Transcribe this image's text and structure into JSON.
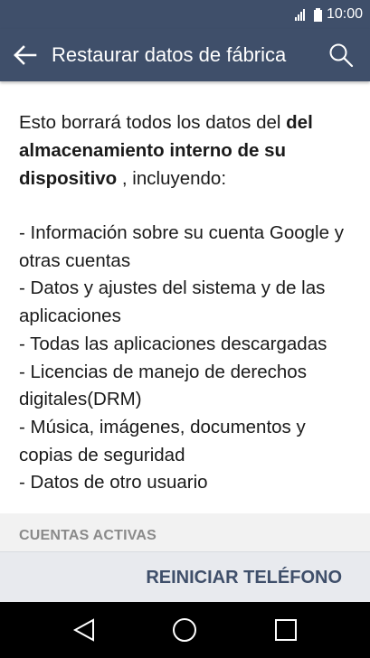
{
  "status_bar": {
    "time": "10:00",
    "signal_icon": "signal-bars-icon",
    "battery_icon": "battery-full-icon"
  },
  "app_bar": {
    "title": "Restaurar datos de fábrica",
    "back_icon": "arrow-left-icon",
    "search_icon": "search-icon",
    "background": "#3f4f6a"
  },
  "content": {
    "intro_start": "Esto borrará todos los datos del ",
    "intro_bold": "del almacenamiento interno de su dispositivo",
    "intro_end": " , incluyendo:",
    "items": [
      "- Información sobre su cuenta Google y otras cuentas",
      "- Datos y ajustes del sistema y de las aplicaciones",
      "- Todas las aplicaciones descargadas",
      "- Licencias de manejo de derechos digitales(DRM)",
      "- Música, imágenes, documentos y copias de seguridad",
      "- Datos de otro usuario"
    ]
  },
  "accounts_section": {
    "header": "CUENTAS ACTIVAS"
  },
  "action": {
    "reset_label": "REINICIAR TELÉFONO",
    "color": "#3f4f6a"
  },
  "nav_bar": {
    "back_icon": "triangle-back-icon",
    "home_icon": "circle-home-icon",
    "recent_icon": "square-recent-icon"
  }
}
